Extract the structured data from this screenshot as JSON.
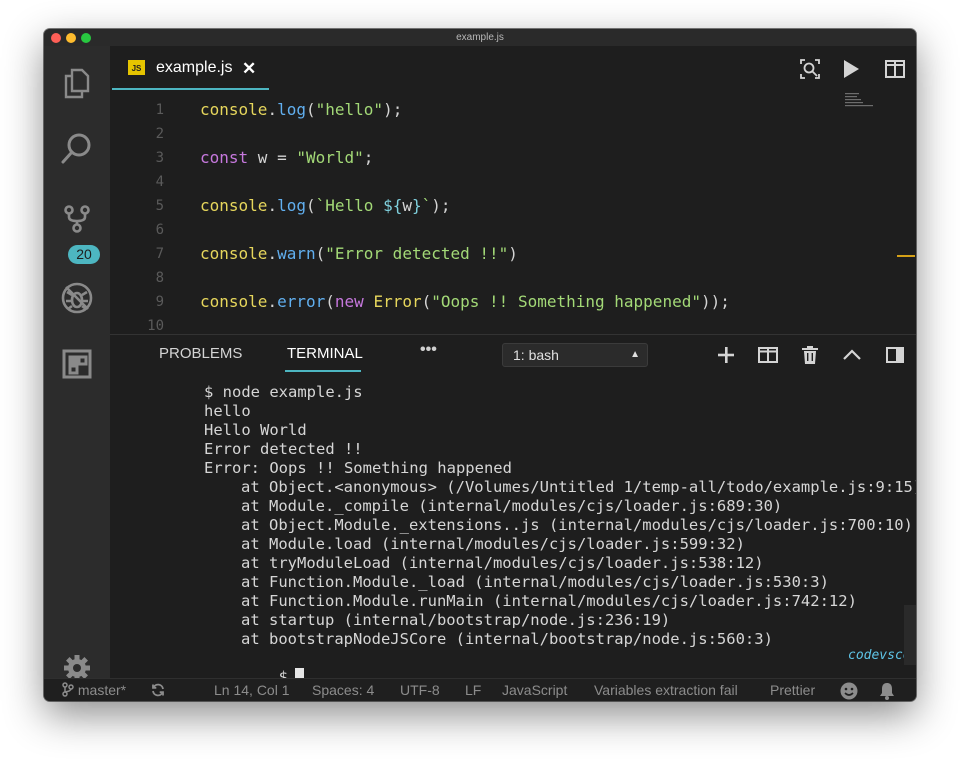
{
  "window": {
    "title": "example.js"
  },
  "activity_bar": {
    "items": [
      "explorer",
      "search",
      "source-control",
      "debug",
      "extensions",
      "settings"
    ],
    "source_control_badge": "20"
  },
  "editor": {
    "tab": {
      "file_icon": "JS",
      "name": "example.js",
      "close": "✕"
    },
    "lines": [
      {
        "n": "1",
        "tokens": [
          [
            "console",
            "yel"
          ],
          [
            ".",
            "wht"
          ],
          [
            "log",
            "blu"
          ],
          [
            "(",
            "wht"
          ],
          [
            "\"hello\"",
            "grn"
          ],
          [
            ");",
            "wht"
          ]
        ]
      },
      {
        "n": "2",
        "tokens": []
      },
      {
        "n": "3",
        "tokens": [
          [
            "const",
            "pur"
          ],
          [
            " w = ",
            "wht"
          ],
          [
            "\"World\"",
            "grn"
          ],
          [
            ";",
            "wht"
          ]
        ]
      },
      {
        "n": "4",
        "tokens": []
      },
      {
        "n": "5",
        "tokens": [
          [
            "console",
            "yel"
          ],
          [
            ".",
            "wht"
          ],
          [
            "log",
            "blu"
          ],
          [
            "(",
            "wht"
          ],
          [
            "`Hello ",
            "grn"
          ],
          [
            "${",
            "teal"
          ],
          [
            "w",
            "wht"
          ],
          [
            "}",
            "teal"
          ],
          [
            "`",
            "grn"
          ],
          [
            ");",
            "wht"
          ]
        ]
      },
      {
        "n": "6",
        "tokens": []
      },
      {
        "n": "7",
        "tokens": [
          [
            "console",
            "yel"
          ],
          [
            ".",
            "wht"
          ],
          [
            "warn",
            "blu"
          ],
          [
            "(",
            "wht"
          ],
          [
            "\"Error detected !!\"",
            "grn"
          ],
          [
            ")",
            "wht"
          ]
        ]
      },
      {
        "n": "8",
        "tokens": []
      },
      {
        "n": "9",
        "tokens": [
          [
            "console",
            "yel"
          ],
          [
            ".",
            "wht"
          ],
          [
            "error",
            "blu"
          ],
          [
            "(",
            "wht"
          ],
          [
            "new",
            "pur"
          ],
          [
            " ",
            "wht"
          ],
          [
            "Error",
            "yel"
          ],
          [
            "(",
            "wht"
          ],
          [
            "\"Oops !! Something happened\"",
            "grn"
          ],
          [
            "));",
            "wht"
          ]
        ]
      },
      {
        "n": "10",
        "tokens": []
      }
    ]
  },
  "panel": {
    "tabs": {
      "problems": "PROBLEMS",
      "terminal": "TERMINAL",
      "more": "•••"
    },
    "terminal_select": "1: bash",
    "terminal_lines": [
      {
        "text": "$ node example.js",
        "indent": false
      },
      {
        "text": "hello",
        "indent": false
      },
      {
        "text": "Hello World",
        "indent": false
      },
      {
        "text": "Error detected !!",
        "indent": false
      },
      {
        "text": "Error: Oops !! Something happened",
        "indent": false
      },
      {
        "text": "at Object.<anonymous> (/Volumes/Untitled 1/temp-all/todo/example.js:9:15)",
        "indent": true
      },
      {
        "text": "at Module._compile (internal/modules/cjs/loader.js:689:30)",
        "indent": true
      },
      {
        "text": "at Object.Module._extensions..js (internal/modules/cjs/loader.js:700:10)",
        "indent": true
      },
      {
        "text": "at Module.load (internal/modules/cjs/loader.js:599:32)",
        "indent": true
      },
      {
        "text": "at tryModuleLoad (internal/modules/cjs/loader.js:538:12)",
        "indent": true
      },
      {
        "text": "at Function.Module._load (internal/modules/cjs/loader.js:530:3)",
        "indent": true
      },
      {
        "text": "at Function.Module.runMain (internal/modules/cjs/loader.js:742:12)",
        "indent": true
      },
      {
        "text": "at startup (internal/bootstrap/node.js:236:19)",
        "indent": true
      },
      {
        "text": "at bootstrapNodeJSCore (internal/bootstrap/node.js:560:3)",
        "indent": true
      }
    ],
    "prompt": "$",
    "watermark": "codevscolor.com"
  },
  "status_bar": {
    "branch": "master*",
    "position": "Ln 14, Col 1",
    "spaces": "Spaces: 4",
    "encoding": "UTF-8",
    "eol": "LF",
    "language": "JavaScript",
    "extension_msg": "Variables extraction fail",
    "formatter": "Prettier"
  },
  "colors": {
    "accent": "#4db6c1",
    "background": "#1e1e1e",
    "keyword": "#c678dd",
    "string": "#a3d977",
    "object": "#e6d65c",
    "method": "#61afef"
  }
}
